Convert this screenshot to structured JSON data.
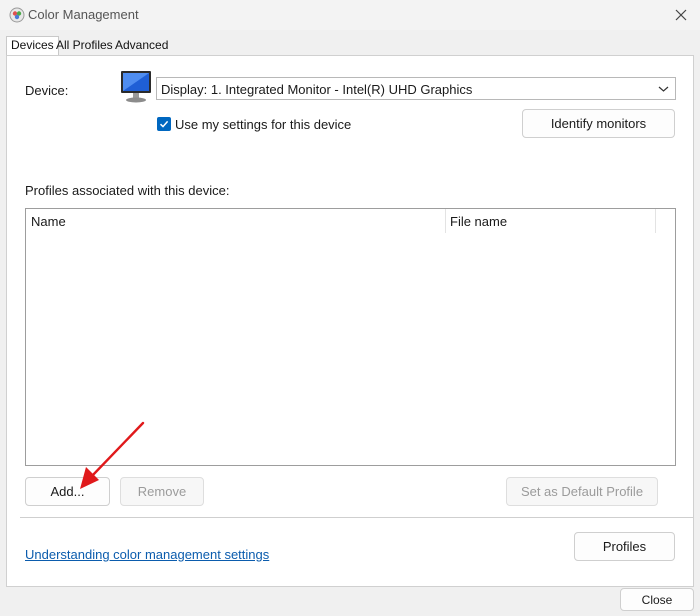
{
  "window": {
    "title": "Color Management"
  },
  "tabs": [
    {
      "label": "Devices"
    },
    {
      "label": "All Profiles"
    },
    {
      "label": "Advanced"
    }
  ],
  "device": {
    "label": "Device:",
    "selected": "Display: 1. Integrated Monitor - Intel(R) UHD Graphics",
    "use_my_settings_label": "Use my settings for this device",
    "use_my_settings_checked": true,
    "identify_button": "Identify monitors"
  },
  "profiles": {
    "caption": "Profiles associated with this device:",
    "columns": [
      "Name",
      "File name"
    ],
    "rows": []
  },
  "actions": {
    "add": "Add...",
    "remove": "Remove",
    "set_default": "Set as Default Profile"
  },
  "footer": {
    "link": "Understanding color management settings",
    "profiles_button": "Profiles",
    "close_button": "Close"
  },
  "colors": {
    "accent": "#0067c0",
    "link": "#0b5cad",
    "annotation_arrow": "#e0191b"
  },
  "icons": {
    "app": "color-management-icon",
    "monitor": "monitor-icon",
    "close": "close-icon",
    "dropdown": "chevron-down-icon",
    "check": "check-icon"
  }
}
